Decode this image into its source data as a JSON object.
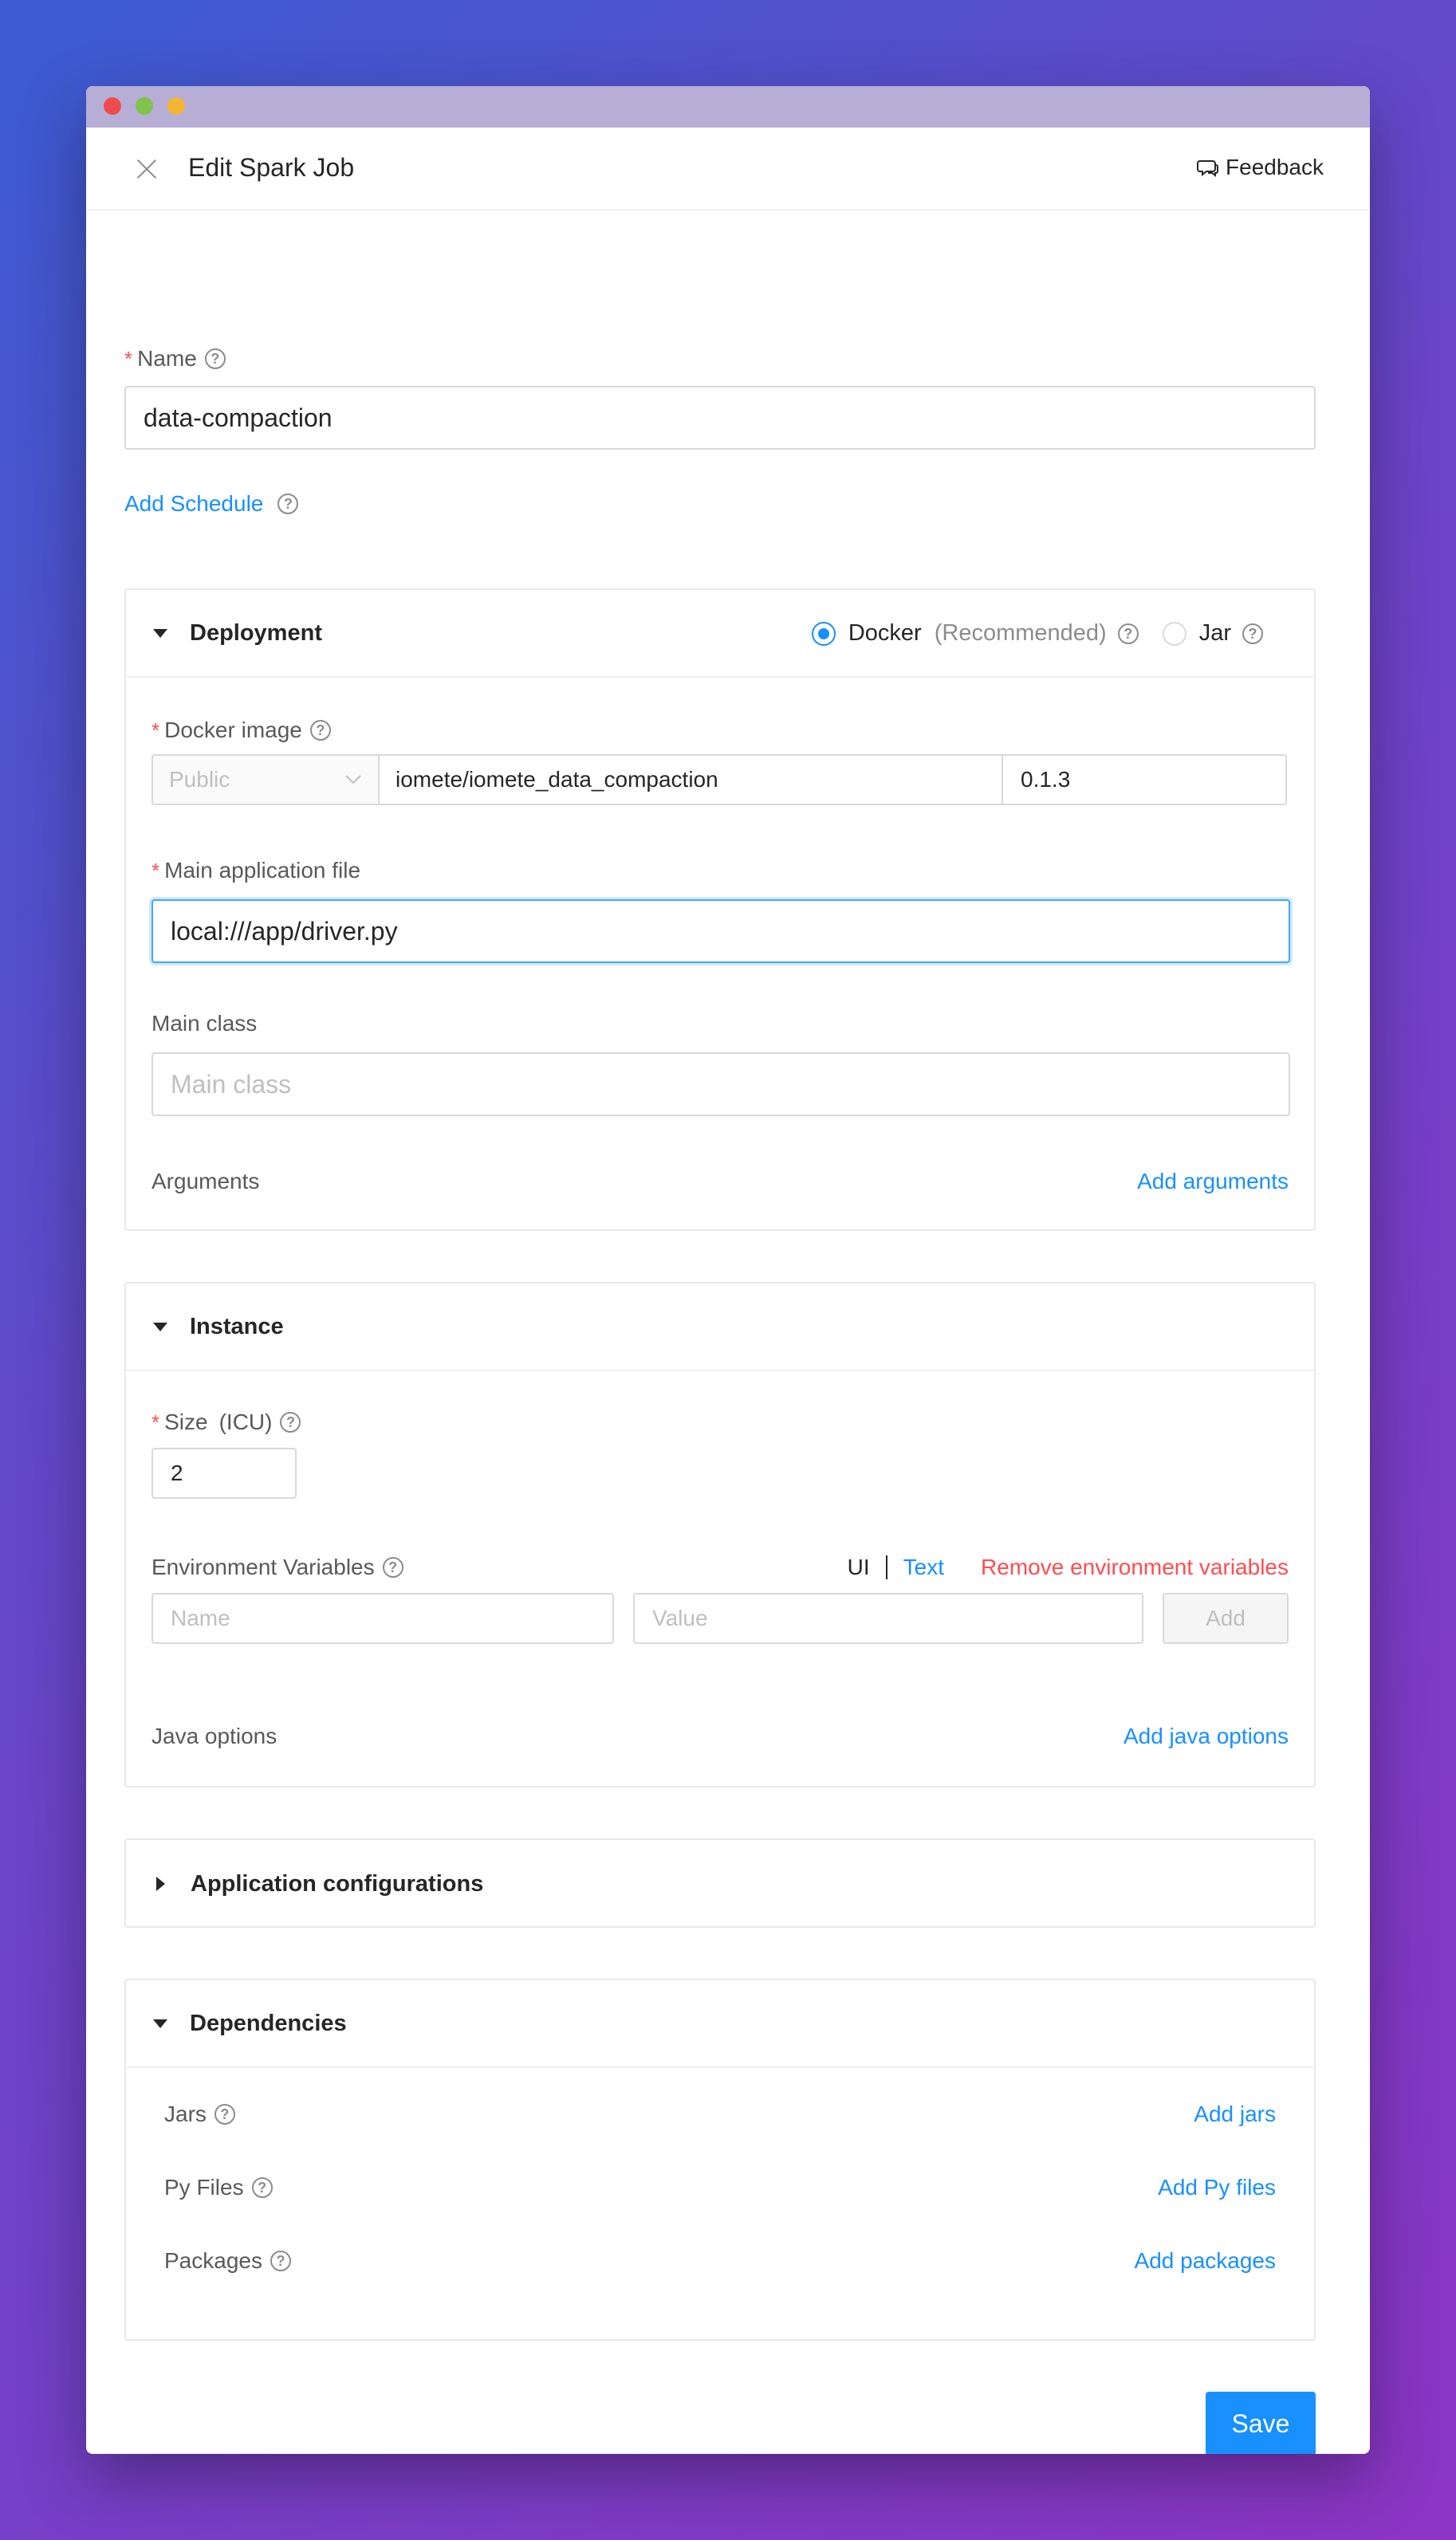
{
  "window": {
    "title": "Edit Spark Job",
    "feedback_label": "Feedback"
  },
  "form": {
    "name_label": "Name",
    "name_value": "data-compaction",
    "add_schedule": "Add Schedule"
  },
  "deployment": {
    "title": "Deployment",
    "docker_label": "Docker",
    "docker_note": "(Recommended)",
    "jar_label": "Jar",
    "docker_image_label": "Docker image",
    "registry_value": "Public",
    "image_value": "iomete/iomete_data_compaction",
    "tag_value": "0.1.3",
    "main_file_label": "Main application file",
    "main_file_value": "local:///app/driver.py",
    "main_class_label": "Main class",
    "main_class_placeholder": "Main class",
    "arguments_label": "Arguments",
    "add_arguments": "Add arguments"
  },
  "instance": {
    "title": "Instance",
    "size_label": "Size",
    "size_unit": "(ICU)",
    "size_value": "2",
    "env_label": "Environment Variables",
    "mode_ui": "UI",
    "mode_text": "Text",
    "remove_env": "Remove environment variables",
    "env_name_placeholder": "Name",
    "env_value_placeholder": "Value",
    "env_add": "Add",
    "java_label": "Java options",
    "add_java": "Add java options"
  },
  "app_config": {
    "title": "Application configurations"
  },
  "dependencies": {
    "title": "Dependencies",
    "jars_label": "Jars",
    "add_jars": "Add jars",
    "py_label": "Py Files",
    "add_py": "Add Py files",
    "packages_label": "Packages",
    "add_packages": "Add packages"
  },
  "footer": {
    "save_label": "Save"
  },
  "colors": {
    "accent": "#1890ff",
    "danger": "#ff4d4f"
  }
}
